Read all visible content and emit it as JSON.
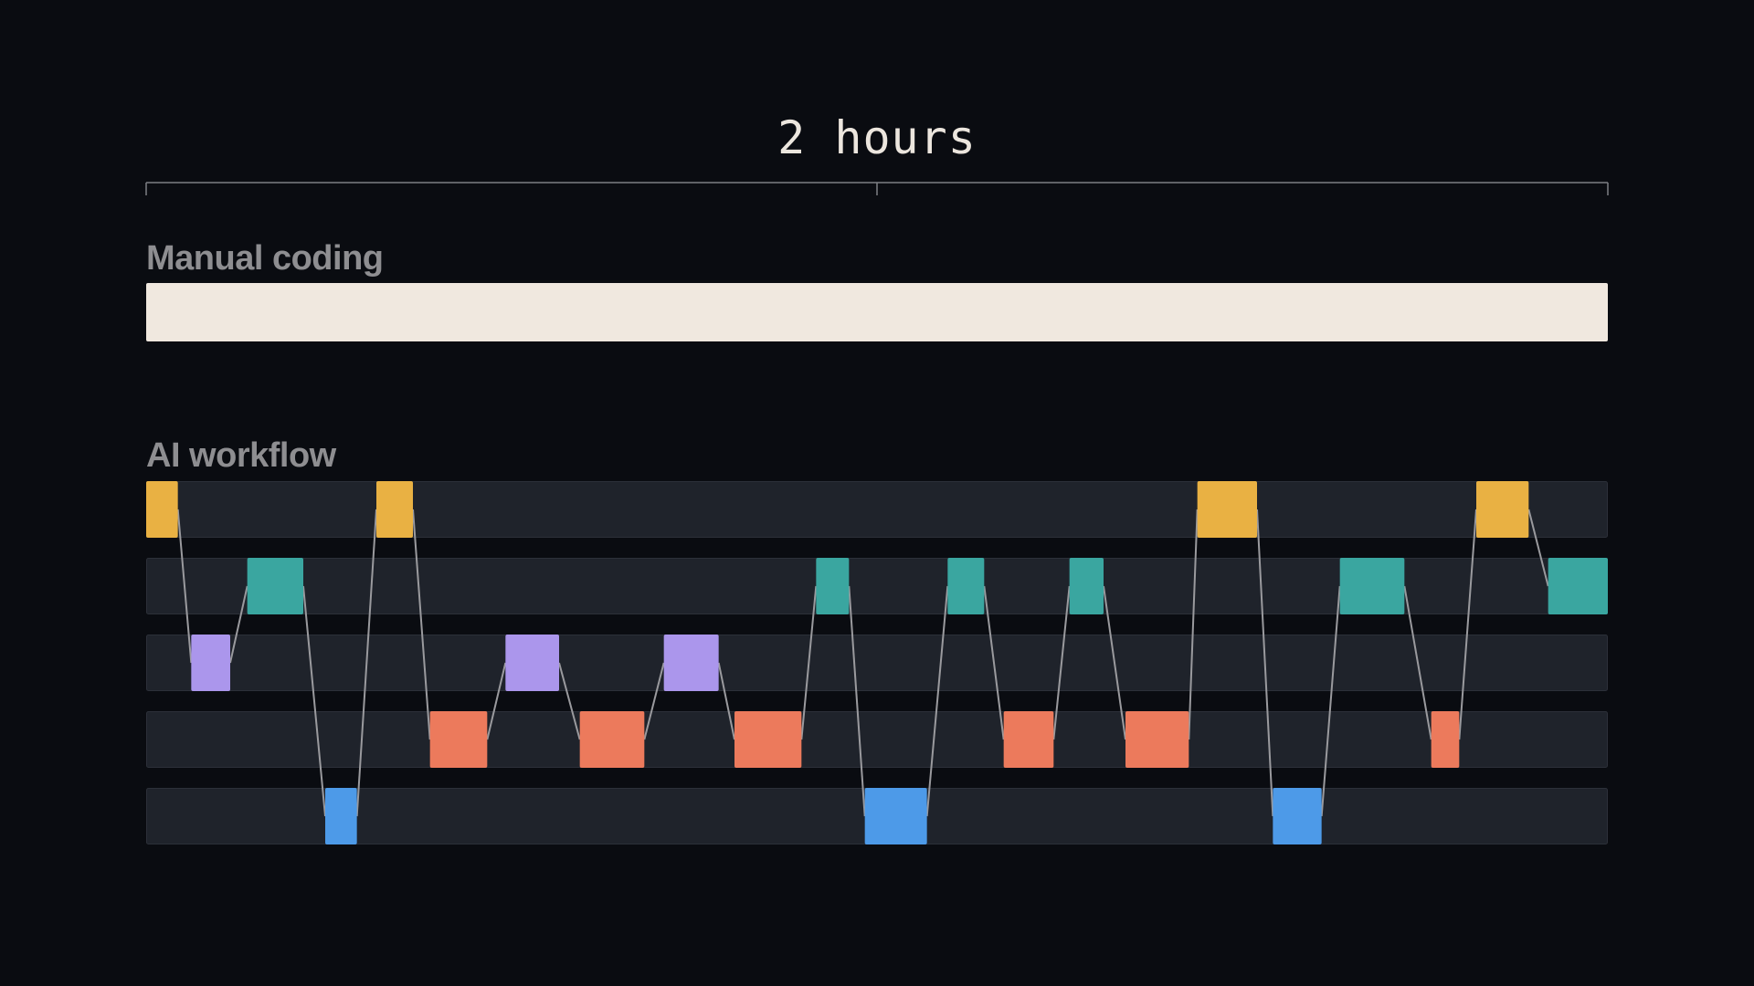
{
  "duration": {
    "label": "2 hours",
    "total": 120,
    "unit": "minutes"
  },
  "manual": {
    "label": "Manual coding",
    "color": "#f0e8df"
  },
  "ai": {
    "label": "AI workflow",
    "lane_color": "#1f232b",
    "lane_border": "#2c3039",
    "connector_color": "#9a9a9e",
    "lanes": [
      {
        "id": 0,
        "color": "#e9b143"
      },
      {
        "id": 1,
        "color": "#3aa6a0"
      },
      {
        "id": 2,
        "color": "#ab96ec"
      },
      {
        "id": 3,
        "color": "#ec7a5c"
      },
      {
        "id": 4,
        "color": "#4d9ae8"
      }
    ],
    "segments": [
      {
        "lane": 0,
        "start": 0.0,
        "end": 2.6
      },
      {
        "lane": 2,
        "start": 3.7,
        "end": 6.9
      },
      {
        "lane": 1,
        "start": 8.3,
        "end": 12.9
      },
      {
        "lane": 4,
        "start": 14.7,
        "end": 17.3
      },
      {
        "lane": 0,
        "start": 18.9,
        "end": 21.9
      },
      {
        "lane": 3,
        "start": 23.3,
        "end": 28.0
      },
      {
        "lane": 2,
        "start": 29.5,
        "end": 33.9
      },
      {
        "lane": 3,
        "start": 35.6,
        "end": 40.9
      },
      {
        "lane": 2,
        "start": 42.5,
        "end": 47.0
      },
      {
        "lane": 3,
        "start": 48.3,
        "end": 53.8
      },
      {
        "lane": 1,
        "start": 55.0,
        "end": 57.7
      },
      {
        "lane": 4,
        "start": 59.0,
        "end": 64.1
      },
      {
        "lane": 1,
        "start": 65.8,
        "end": 68.8
      },
      {
        "lane": 3,
        "start": 70.4,
        "end": 74.5
      },
      {
        "lane": 1,
        "start": 75.8,
        "end": 78.6
      },
      {
        "lane": 3,
        "start": 80.4,
        "end": 85.6
      },
      {
        "lane": 0,
        "start": 86.3,
        "end": 91.2
      },
      {
        "lane": 4,
        "start": 92.5,
        "end": 96.5
      },
      {
        "lane": 1,
        "start": 98.0,
        "end": 103.3
      },
      {
        "lane": 3,
        "start": 105.5,
        "end": 107.8
      },
      {
        "lane": 0,
        "start": 109.2,
        "end": 113.5
      },
      {
        "lane": 1,
        "start": 115.1,
        "end": 120.0
      }
    ]
  }
}
